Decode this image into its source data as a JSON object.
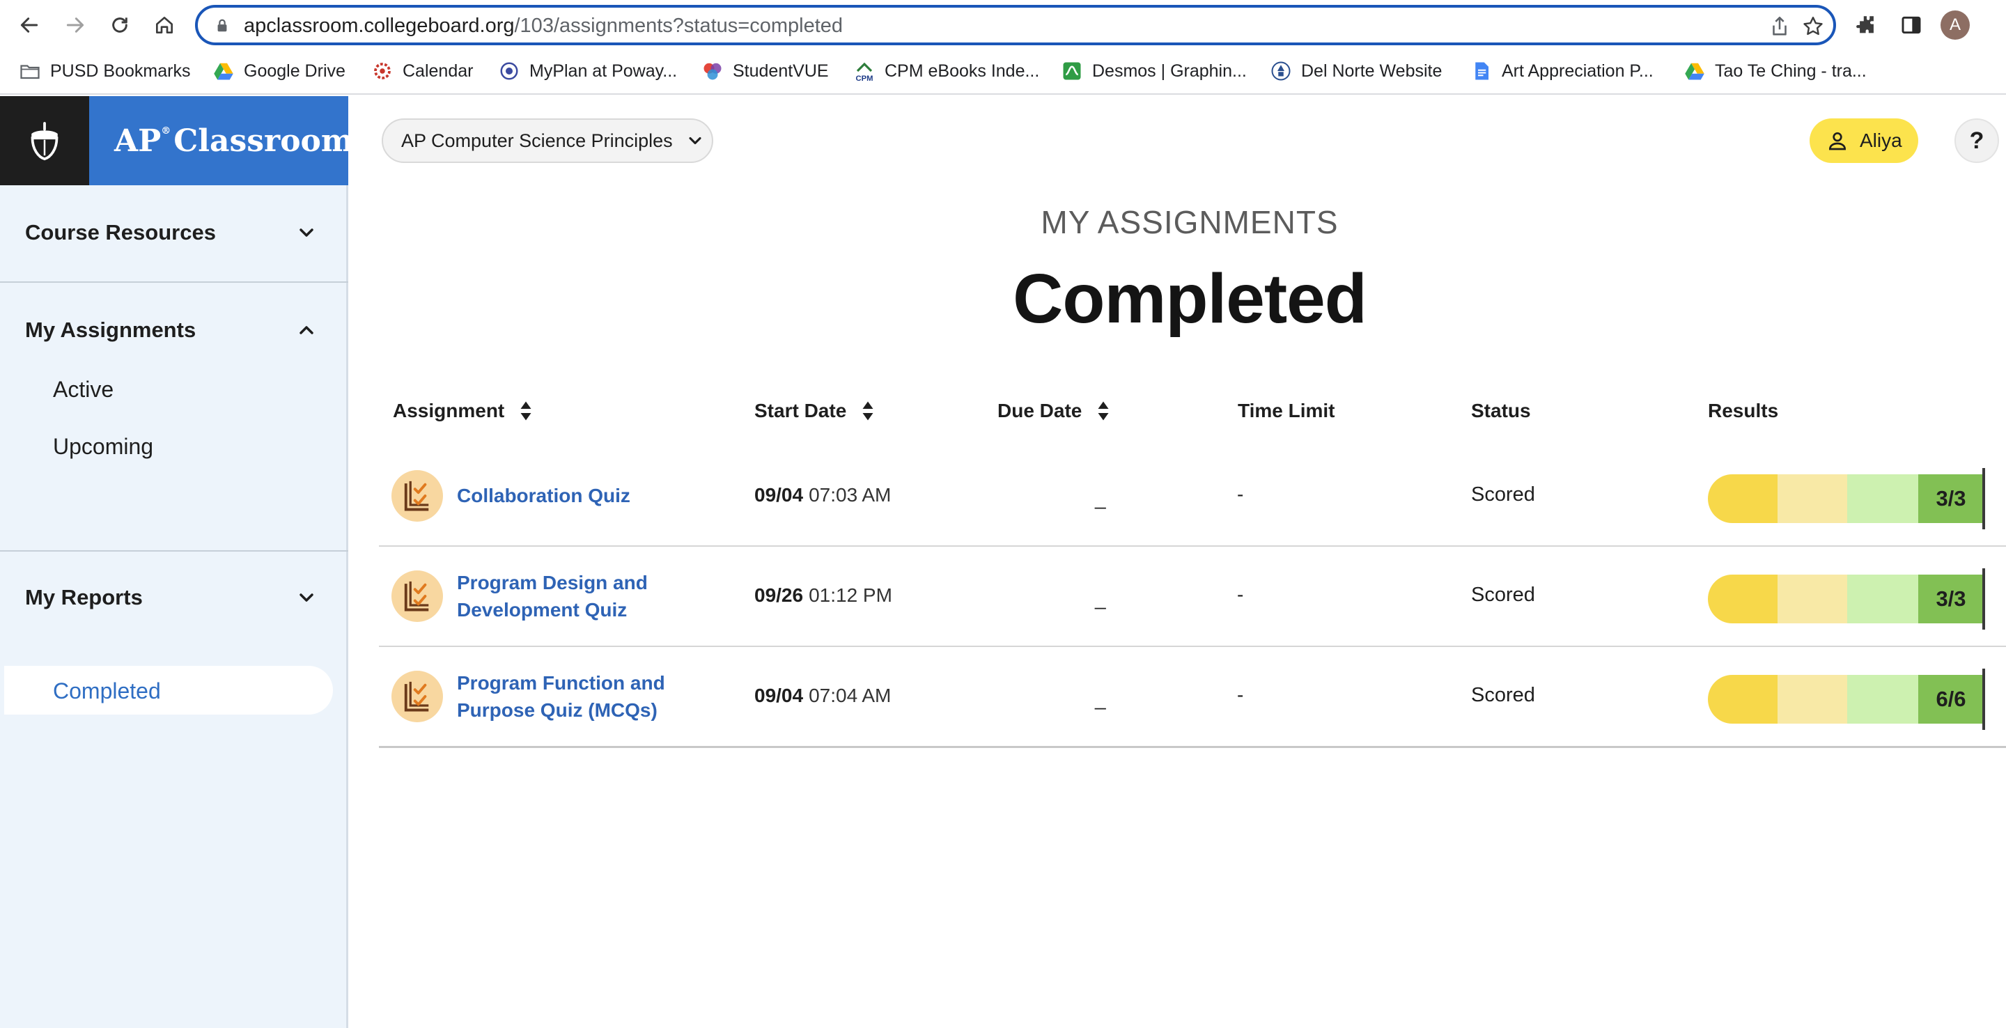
{
  "browser": {
    "url_host": "apclassroom.collegeboard.org",
    "url_path": "/103/assignments?status=completed",
    "profile_initial": "A",
    "bookmarks": [
      {
        "label": "PUSD Bookmarks",
        "icon": "folder-icon"
      },
      {
        "label": "Google Drive",
        "icon": "google-drive-icon"
      },
      {
        "label": "Calendar",
        "icon": "calendar-icon"
      },
      {
        "label": "MyPlan at Poway...",
        "icon": "myplan-icon"
      },
      {
        "label": "StudentVUE",
        "icon": "studentvue-icon"
      },
      {
        "label": "CPM eBooks Inde...",
        "icon": "cpm-icon"
      },
      {
        "label": "Desmos | Graphin...",
        "icon": "desmos-icon"
      },
      {
        "label": "Del Norte Website",
        "icon": "school-icon"
      },
      {
        "label": "Art Appreciation P...",
        "icon": "google-docs-icon"
      },
      {
        "label": "Tao Te Ching - tra...",
        "icon": "google-drive-icon"
      }
    ]
  },
  "app": {
    "brand_prefix": "AP",
    "brand_mark": "®",
    "brand_suffix": "Classroom",
    "course": "AP Computer Science Principles",
    "user": "Aliya",
    "help": "?"
  },
  "sidebar": {
    "course_resources": "Course Resources",
    "my_assignments": "My Assignments",
    "items": [
      "Active",
      "Upcoming",
      "Completed"
    ],
    "active_item": "Completed",
    "my_reports": "My Reports"
  },
  "page": {
    "kicker": "MY ASSIGNMENTS",
    "title": "Completed"
  },
  "table": {
    "headers": [
      "Assignment",
      "Start Date",
      "Due Date",
      "Time Limit",
      "Status",
      "Results"
    ],
    "rows": [
      {
        "title_line1": "Collaboration Quiz",
        "title_line2": "",
        "start_day": "09/04",
        "start_time": "07:03 AM",
        "due": "_",
        "time_limit": "-",
        "status": "Scored",
        "score": "3/3",
        "fraction": 1.0
      },
      {
        "title_line1": "Program Design and",
        "title_line2": "Development Quiz",
        "start_day": "09/26",
        "start_time": "01:12 PM",
        "due": "_",
        "time_limit": "-",
        "status": "Scored",
        "score": "3/3",
        "fraction": 1.0
      },
      {
        "title_line1": "Program Function and",
        "title_line2": "Purpose Quiz (MCQs)",
        "start_day": "09/04",
        "start_time": "07:04 AM",
        "due": "_",
        "time_limit": "-",
        "status": "Scored",
        "score": "6/6",
        "fraction": 1.0
      }
    ]
  },
  "colors": {
    "brand_blue": "#3374cc",
    "link_blue": "#2e63b5",
    "user_yellow": "#fce34d",
    "score_band_1": "#f7d84a",
    "score_band_2": "#f8e9a6",
    "score_band_3": "#cdf1b0",
    "score_band_4": "#82c054"
  }
}
